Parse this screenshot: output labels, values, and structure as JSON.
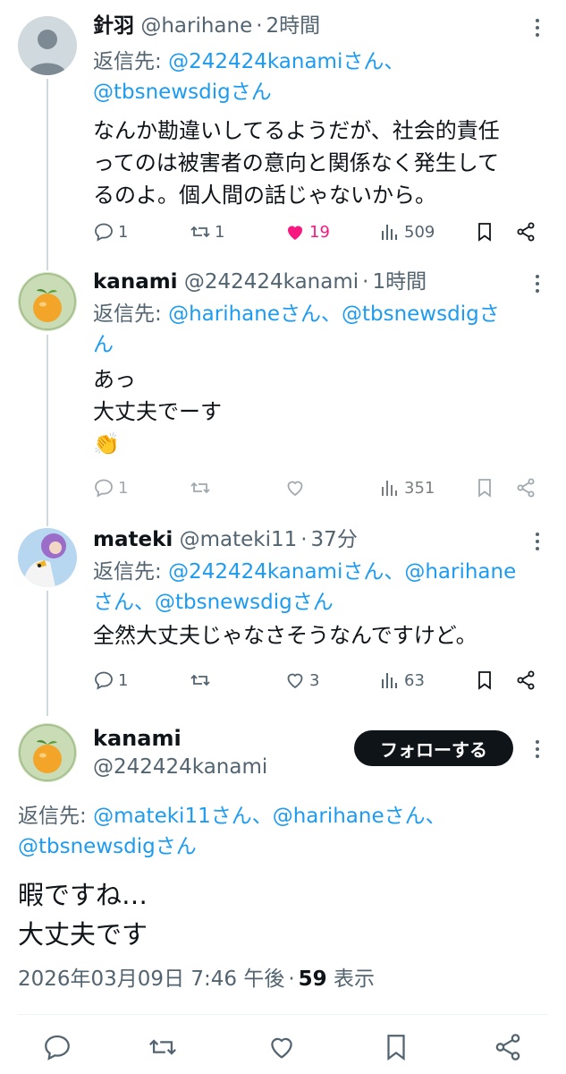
{
  "tweets": [
    {
      "name": "針羽",
      "handle": "@harihane",
      "time": "2時間",
      "reply_prefix": "返信先: ",
      "reply_mentions_1": "@242424kanamiさん、",
      "reply_mentions_2": "@tbsnewsdigさん",
      "text": "なんか勘違いしてるようだが、社会的責任\nってのは被害者の意向と関係なく発生して\nるのよ。個人間の話じゃないから。",
      "replies": "1",
      "retweets": "1",
      "likes": "19",
      "views": "509",
      "liked": true
    },
    {
      "name": "kanami",
      "handle": "@242424kanami",
      "time": "1時間",
      "reply_prefix": "返信先: ",
      "reply_mentions_1": "@harihaneさん、@tbsnewsdigさ",
      "reply_mentions_2": "ん",
      "text": "あっ\n大丈夫でーす",
      "emoji": "👏",
      "replies": "1",
      "retweets": "",
      "likes": "",
      "views": "351"
    },
    {
      "name": "mateki",
      "handle": "@mateki11",
      "time": "37分",
      "reply_prefix": "返信先: ",
      "reply_mentions_1": "@242424kanamiさん、@harihane",
      "reply_mentions_2": "さん、@tbsnewsdigさん",
      "text": "全然大丈夫じゃなさそうなんですけど。",
      "replies": "1",
      "retweets": "",
      "likes": "3",
      "views": "63"
    }
  ],
  "main": {
    "name": "kanami",
    "handle": "@242424kanami",
    "follow_label": "フォローする",
    "reply_prefix": "返信先: ",
    "reply_mentions_1": "@mateki11さん、@harihaneさん、",
    "reply_mentions_2": "@tbsnewsdigさん",
    "text": "暇ですね…\n大丈夫です",
    "timestamp": "2026年03月09日 7:46 午後",
    "views_count": "59",
    "views_label": "表示"
  },
  "colors": {
    "accent": "#1d9bf0",
    "like": "#f91880",
    "muted": "#536471",
    "text": "#0f1419"
  },
  "icons": [
    "reply-icon",
    "retweet-icon",
    "like-icon",
    "views-icon",
    "bookmark-icon",
    "share-icon",
    "more-icon"
  ]
}
